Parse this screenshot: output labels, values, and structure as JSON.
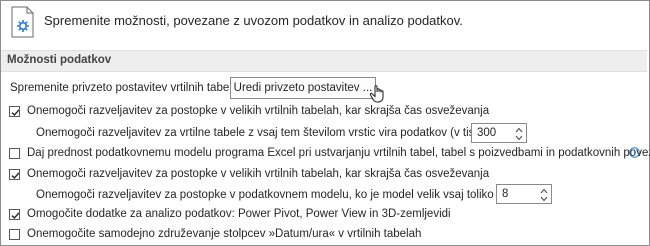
{
  "header": {
    "description": "Spremenite možnosti, povezane z uvozom podatkov in analizo podatkov.",
    "icon": "data-options-icon"
  },
  "section": {
    "title": "Možnosti podatkov"
  },
  "pivot_defaults": {
    "label": "Spremenite privzeto postavitev vrtilnih tabel:",
    "button_label": "Uredi privzeto postavitev ..."
  },
  "options": [
    {
      "id": "disable-undo-large-pivot",
      "label": "Onemogoči razveljavitev za postopke v velikih vrtilnih tabelah, kar skrajša čas osveževanja",
      "checked": true
    },
    {
      "id": "daj-prednost",
      "label": "Daj prednost podatkovnemu modelu programa Excel pri ustvarjanju vrtilnih tabel, tabel s poizvedbami in podatkovnih povezav",
      "checked": false
    },
    {
      "id": "disable-undo-large-model",
      "label": "Onemogoči razveljavitev za postopke v velikih vrtilnih tabelah, kar skrajša čas osveževanja",
      "checked": true
    },
    {
      "id": "enable-addins",
      "label": "Omogočite dodatke za analizo podatkov: Power Pivot, Power View in 3D-zemljevidi",
      "checked": true
    },
    {
      "id": "disable-auto-grouping",
      "label": "Onemogočite samodejno združevanje stolpcev »Datum/ura« v vrtilnih tabelah",
      "checked": false
    }
  ],
  "pivot_threshold": {
    "label": "Onemogoči razveljavitev za vrtilne tabele z vsaj tem številom vrstic vira podatkov (v tisočih):",
    "value": "300"
  },
  "model_threshold": {
    "label": "Onemogoči razveljavitev za postopke v podatkovnem modelu, ko je model velik vsaj toliko (v MB):",
    "value": "8"
  },
  "colors": {
    "check": "#262626",
    "section_bg": "#eeeeee",
    "icon_blue": "#2b79d0"
  }
}
